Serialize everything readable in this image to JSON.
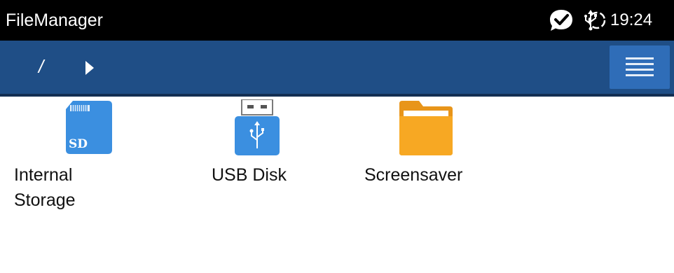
{
  "status_bar": {
    "app_title": "FileManager",
    "time": "19:24",
    "icons": [
      "chat-check-icon",
      "usb-icon",
      "sync-icon"
    ]
  },
  "nav": {
    "breadcrumb_root": "/",
    "menu_icon": "menu-icon"
  },
  "files": [
    {
      "label_line1": "Internal",
      "label_line2": "Storage",
      "icon": "sd-card-icon",
      "icon_text": "SD"
    },
    {
      "label_line1": "USB Disk",
      "label_line2": "",
      "icon": "usb-drive-icon"
    },
    {
      "label_line1": "Screensaver",
      "label_line2": "",
      "icon": "folder-icon"
    }
  ],
  "colors": {
    "status_bar": "#000000",
    "nav_bar": "#1f4e86",
    "menu_button": "#2f6db8",
    "folder": "#f7a823",
    "sd_card": "#3b8fe0"
  }
}
